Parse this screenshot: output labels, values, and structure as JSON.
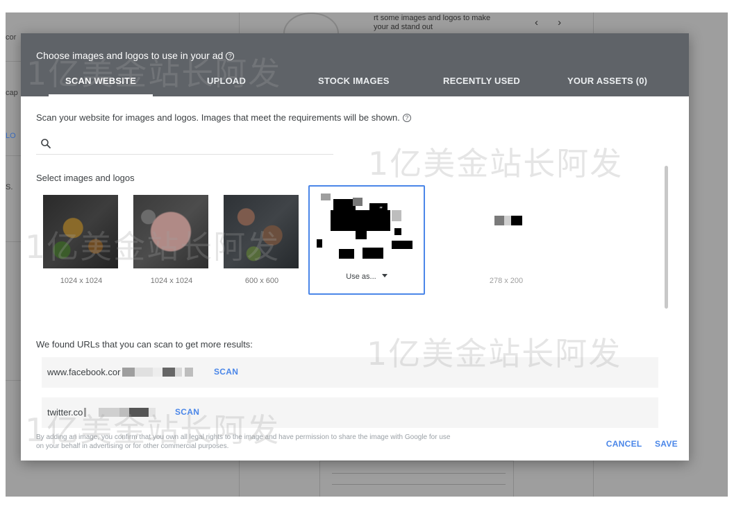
{
  "background": {
    "left_labels": [
      "cor",
      "cap",
      "LO",
      "S."
    ],
    "top_text": [
      "rt some images and logos to make",
      "your ad stand out"
    ],
    "arrows": "‹  ›"
  },
  "dialog": {
    "title": "Choose images and logos to use in your ad",
    "tabs": [
      {
        "label": "SCAN WEBSITE",
        "active": true
      },
      {
        "label": "UPLOAD",
        "active": false
      },
      {
        "label": "STOCK IMAGES",
        "active": false
      },
      {
        "label": "RECENTLY USED",
        "active": false
      },
      {
        "label": "YOUR ASSETS (0)",
        "active": false
      }
    ],
    "intro": "Scan your website for images and logos. Images that meet the requirements will be shown.",
    "search_placeholder": "",
    "select_label": "Select images and logos",
    "thumbnails": [
      {
        "caption": "1024 x 1024"
      },
      {
        "caption": "1024 x 1024"
      },
      {
        "caption": "600 x 600"
      },
      {
        "caption": "Use as...",
        "selected": true
      },
      {
        "caption": "278 x 200"
      }
    ],
    "urls_label": "We found URLs that you can scan to get more results:",
    "urls": [
      {
        "text": "www.facebook.cor",
        "action": "SCAN"
      },
      {
        "text": "twitter.co",
        "action": "SCAN"
      }
    ],
    "disclaimer": "By adding an image, you confirm that you own all legal rights to the image and have permission to share the image with Google for use on your behalf in advertising or for other commercial purposes.",
    "cancel_label": "CANCEL",
    "save_label": "SAVE"
  },
  "watermark": "1亿美金站长阿发",
  "colors": {
    "header": "#5f6368",
    "accent": "#4a86e8"
  }
}
